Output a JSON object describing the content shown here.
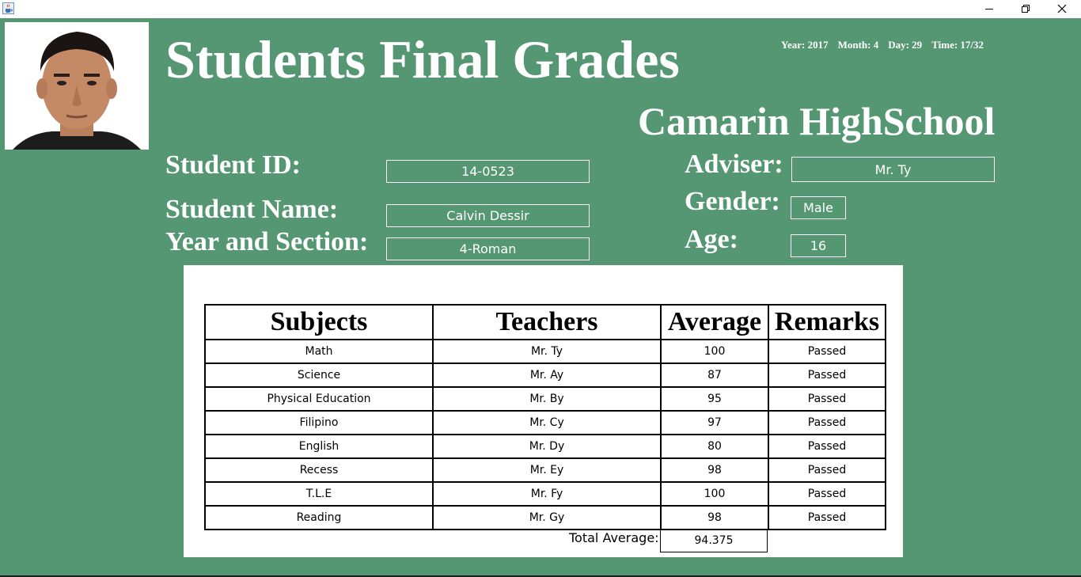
{
  "window": {
    "icon": "java-cup-icon",
    "controls": [
      "minimize-icon",
      "restore-icon",
      "close-icon"
    ]
  },
  "header": {
    "title": "Students Final Grades",
    "school": "Camarin HighSchool",
    "datetime": {
      "year": "Year: 2017",
      "month": "Month: 4",
      "day": "Day: 29",
      "time": "Time: 17/32"
    }
  },
  "student": {
    "id_label": "Student ID:",
    "id_value": "14-0523",
    "name_label": "Student Name:",
    "name_value": "Calvin Dessir",
    "section_label": "Year and Section:",
    "section_value": "4-Roman",
    "adviser_label": "Adviser:",
    "adviser_value": "Mr. Ty",
    "gender_label": "Gender:",
    "gender_value": "Male",
    "age_label": "Age:",
    "age_value": "16"
  },
  "grades": {
    "headers": [
      "Subjects",
      "Teachers",
      "Average",
      "Remarks"
    ],
    "rows": [
      {
        "subject": "Math",
        "teacher": "Mr. Ty",
        "average": "100",
        "remarks": "Passed"
      },
      {
        "subject": "Science",
        "teacher": "Mr. Ay",
        "average": "87",
        "remarks": "Passed"
      },
      {
        "subject": "Physical Education",
        "teacher": "Mr. By",
        "average": "95",
        "remarks": "Passed"
      },
      {
        "subject": "Filipino",
        "teacher": "Mr. Cy",
        "average": "97",
        "remarks": "Passed"
      },
      {
        "subject": "English",
        "teacher": "Mr. Dy",
        "average": "80",
        "remarks": "Passed"
      },
      {
        "subject": "Recess",
        "teacher": "Mr. Ey",
        "average": "98",
        "remarks": "Passed"
      },
      {
        "subject": "T.L.E",
        "teacher": "Mr. Fy",
        "average": "100",
        "remarks": "Passed"
      },
      {
        "subject": "Reading",
        "teacher": "Mr. Gy",
        "average": "98",
        "remarks": "Passed"
      }
    ],
    "total_label": "Total Average:",
    "total_value": "94.375"
  },
  "colors": {
    "panel_green": "#559772",
    "table_bg": "#ffffff",
    "text_white": "#ffffff"
  }
}
